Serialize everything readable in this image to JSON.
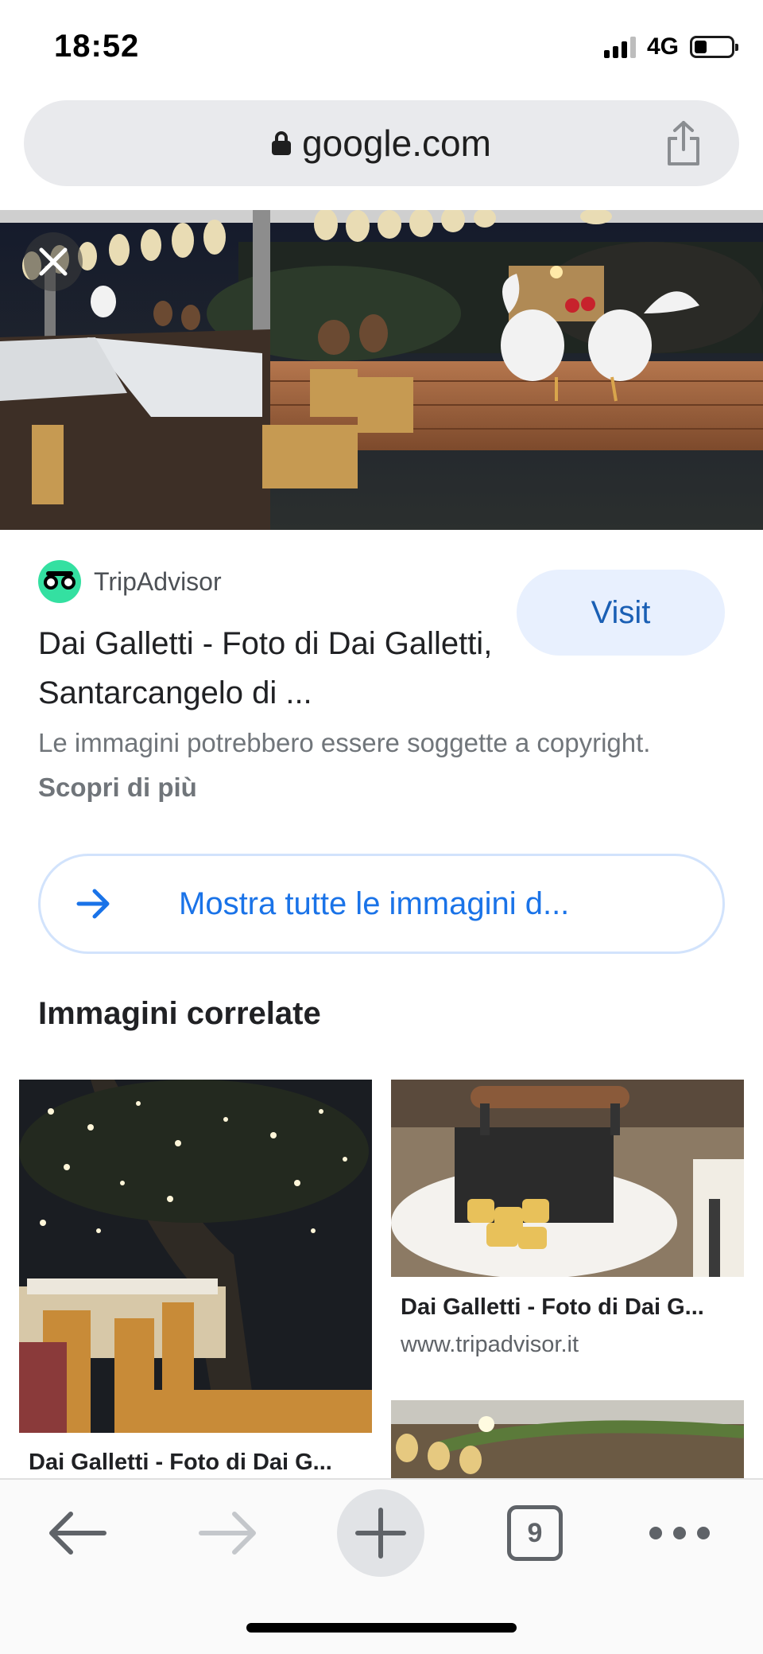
{
  "status_bar": {
    "time": "18:52",
    "network": "4G",
    "battery_level": 0.35
  },
  "browser": {
    "url": "google.com",
    "icons": {
      "lock": "lock-icon",
      "share": "share-icon"
    }
  },
  "result": {
    "source_name": "TripAdvisor",
    "visit_label": "Visit",
    "title": "Dai Galletti - Foto di Dai Galletti, Santarcangelo di ...",
    "copyright_text": "Le immagini potrebbero essere soggette a copyright.",
    "learn_more": "Scopri di più",
    "show_all_label": "Mostra tutte le immagini d..."
  },
  "related": {
    "heading": "Immagini correlate",
    "items": [
      {
        "title": "Dai Galletti - Foto di Dai G..."
      },
      {
        "title": "Dai Galletti - Foto di Dai G...",
        "source": "www.tripadvisor.it"
      }
    ]
  },
  "toolbar": {
    "tab_count": "9",
    "icons": [
      "back-arrow-icon",
      "forward-arrow-icon",
      "plus-icon",
      "tabs-icon",
      "more-icon"
    ]
  },
  "colors": {
    "accent_blue": "#1a73e8",
    "visit_bg": "#e8f0fe",
    "tripadvisor_green": "#34e0a1",
    "urlbar_bg": "#e9eaed"
  }
}
